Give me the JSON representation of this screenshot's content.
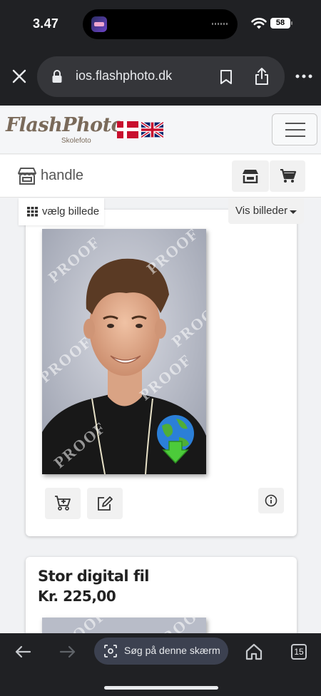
{
  "status": {
    "time": "3.47",
    "battery": "58"
  },
  "browser": {
    "url": "ios.flashphoto.dk",
    "search_label": "Søg på denne skærm",
    "tab_count": "15"
  },
  "site": {
    "logo_text": "FlashPhoto",
    "logo_sub": "Skolefoto",
    "flags": [
      "dk-flag",
      "uk-flag"
    ]
  },
  "shop": {
    "title": "handle"
  },
  "toolbar": {
    "choose_image": "vælg billede",
    "show_images": "Vis billeder"
  },
  "photo": {
    "watermark": "PROOF"
  },
  "product2": {
    "title": "Stor digital fil",
    "price": "Kr. 225,00"
  },
  "icons": [
    "close-icon",
    "lock-icon",
    "bookmark-icon",
    "share-icon",
    "more-icon",
    "store-icon",
    "cart-icon",
    "grid-icon",
    "add-to-cart-icon",
    "edit-icon",
    "info-icon",
    "download-globe-icon",
    "back-icon",
    "forward-icon",
    "lens-icon",
    "home-icon"
  ]
}
